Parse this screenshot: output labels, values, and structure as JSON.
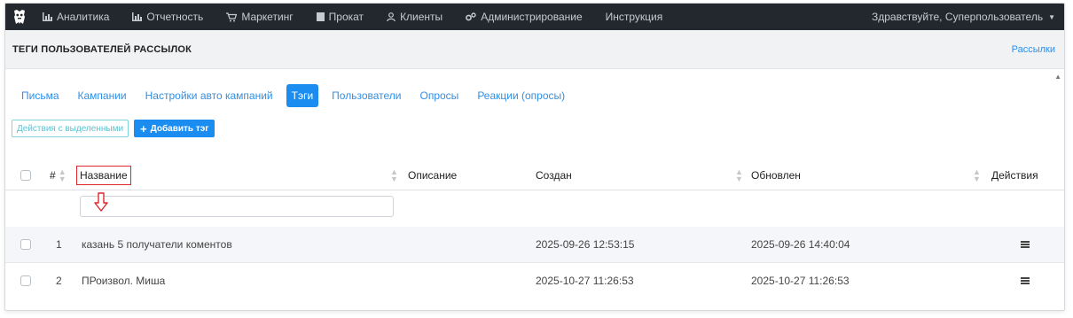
{
  "navbar": {
    "brand_icon": "mascot-logo-icon",
    "items": [
      {
        "label": "Аналитика",
        "icon": "bar-chart-icon"
      },
      {
        "label": "Отчетность",
        "icon": "bar-chart-icon"
      },
      {
        "label": "Маркетинг",
        "icon": "cart-icon"
      },
      {
        "label": "Прокат",
        "icon": "square-icon"
      },
      {
        "label": "Клиенты",
        "icon": "user-icon"
      },
      {
        "label": "Администрирование",
        "icon": "gears-icon"
      },
      {
        "label": "Инструкция",
        "icon": ""
      }
    ],
    "user_greeting": "Здравствуйте, Суперпользователь"
  },
  "header": {
    "title": "ТЕГИ ПОЛЬЗОВАТЕЛЕЙ РАССЫЛОК",
    "breadcrumb": "Рассылки"
  },
  "tabs": [
    {
      "label": "Письма",
      "active": false
    },
    {
      "label": "Кампании",
      "active": false
    },
    {
      "label": "Настройки авто кампаний",
      "active": false
    },
    {
      "label": "Тэги",
      "active": true
    },
    {
      "label": "Пользователи",
      "active": false
    },
    {
      "label": "Опросы",
      "active": false
    },
    {
      "label": "Реакции (опросы)",
      "active": false
    }
  ],
  "toolbar": {
    "bulk_actions_label": "Действия с выделенными",
    "add_tag_label": "Добавить тэг"
  },
  "table": {
    "columns": {
      "number": "#",
      "name": "Название",
      "description": "Описание",
      "created": "Создан",
      "updated": "Обновлен",
      "actions": "Действия"
    },
    "filter_name_value": "",
    "rows": [
      {
        "number": "1",
        "name": "казань 5 получатели коментов",
        "description": "",
        "created": "2025-09-26 12:53:15",
        "updated": "2025-09-26 14:40:04"
      },
      {
        "number": "2",
        "name": "ПРоизвол. Миша",
        "description": "",
        "created": "2025-10-27 11:26:53",
        "updated": "2025-10-27 11:26:53"
      }
    ]
  },
  "colors": {
    "navbar_bg": "#23282e",
    "accent": "#1b8cf0",
    "annotation_red": "#e0262b",
    "outline_button": "#5cc3cf"
  }
}
